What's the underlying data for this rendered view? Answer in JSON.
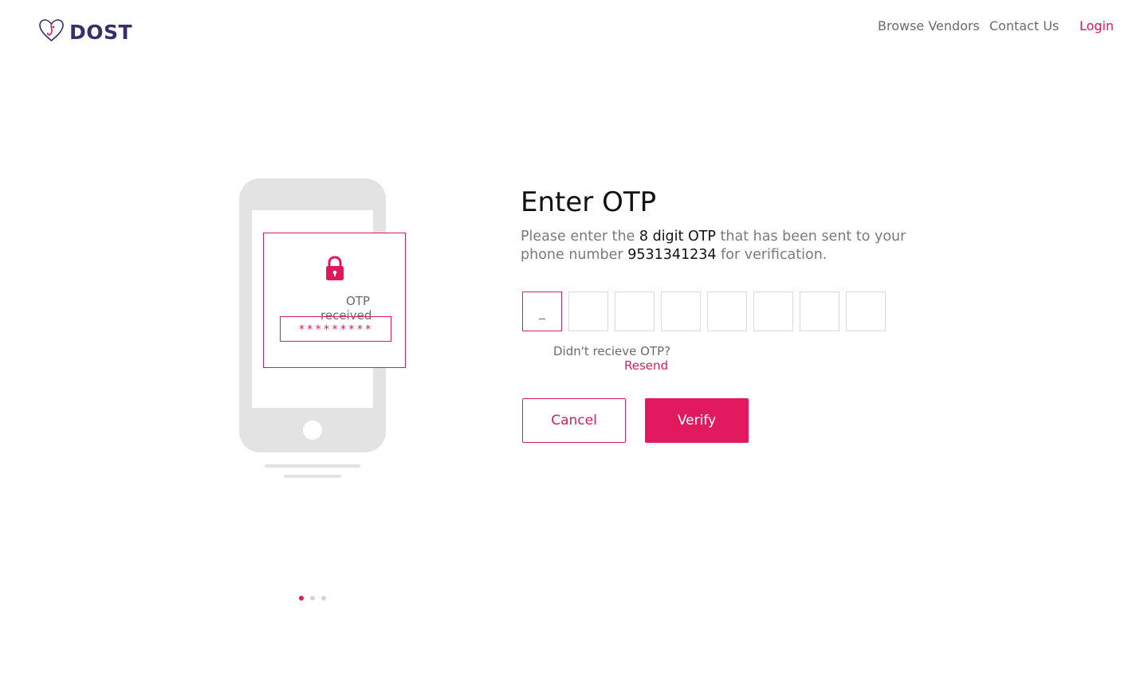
{
  "header": {
    "logo_text": "DOST",
    "nav": [
      {
        "label": "Browse Vendors"
      },
      {
        "label": "Contact Us"
      },
      {
        "label": "Login"
      }
    ]
  },
  "illustration": {
    "card_label": "OTP received",
    "masked_value": "*********",
    "carousel": {
      "count": 3,
      "active": 1
    }
  },
  "form": {
    "title": "Enter OTP",
    "desc_part1": "Please enter the ",
    "desc_highlight1": "8 digit OTP",
    "desc_part2": " that has been sent to your phone number ",
    "desc_phone": "9531341234",
    "desc_part3": " for verification.",
    "otp_digits": [
      "",
      "",
      "",
      "",
      "",
      "",
      "",
      ""
    ],
    "first_placeholder": "_",
    "resend_question": "Didn't recieve OTP?",
    "resend_link": "Resend",
    "cancel_label": "Cancel",
    "verify_label": "Verify"
  },
  "colors": {
    "accent": "#e0195c",
    "brand": "#3d2c6b",
    "muted": "#6b6b6b",
    "phone": "#e3e3e3"
  }
}
